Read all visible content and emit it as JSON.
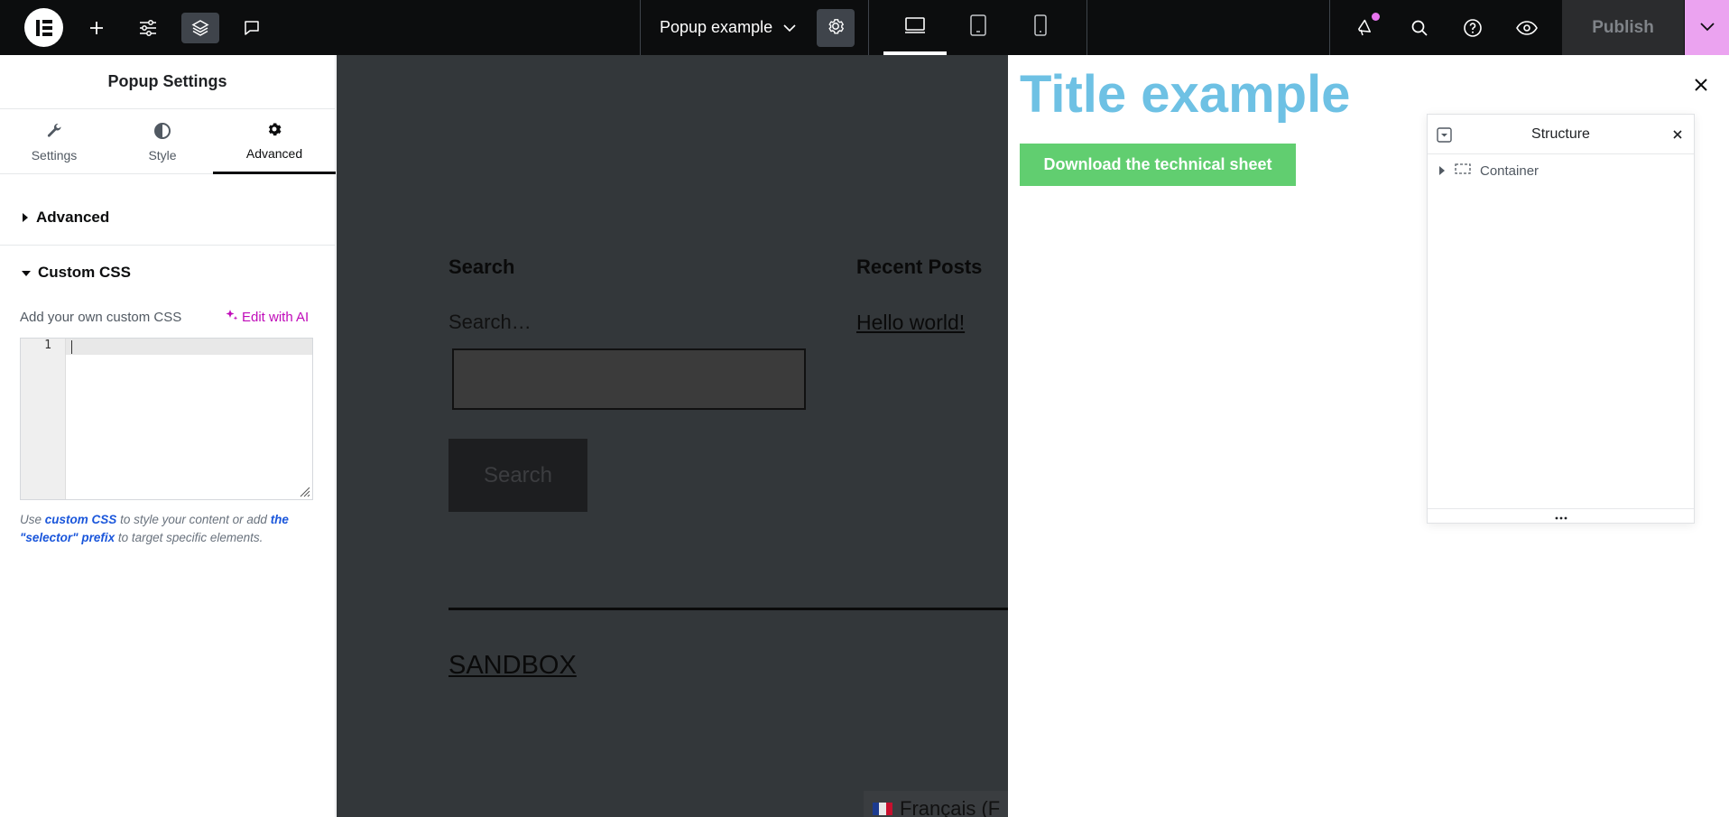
{
  "topbar": {
    "document_title": "Popup example",
    "publish_label": "Publish",
    "icons": [
      "elementor-logo-icon",
      "add-icon",
      "sliders-icon",
      "layers-icon",
      "comment-icon",
      "gear-icon",
      "desktop-icon",
      "tablet-icon",
      "mobile-icon",
      "megaphone-icon",
      "search-icon",
      "help-icon",
      "eye-icon",
      "chevron-down-icon"
    ]
  },
  "panel": {
    "title": "Popup Settings",
    "tabs": [
      {
        "label": "Settings",
        "icon": "wrench-icon"
      },
      {
        "label": "Style",
        "icon": "half-circle-icon"
      },
      {
        "label": "Advanced",
        "icon": "gear-icon",
        "active": true
      }
    ],
    "sections": {
      "advanced": "Advanced",
      "custom_css": "Custom CSS"
    },
    "custom_css_label": "Add your own custom CSS",
    "edit_with_ai": "Edit with AI",
    "line_number": "1",
    "help": {
      "use": "Use",
      "custom_css_link": "custom CSS",
      "middle": "to style your content or add",
      "selector_link": "the \"selector\" prefix",
      "end": "to target specific elements."
    }
  },
  "canvas": {
    "search_heading": "Search",
    "search_label": "Search…",
    "search_button": "Search",
    "recent_heading": "Recent Posts",
    "recent_link": "Hello world!",
    "site_name": "SANDBOX",
    "language": "Français (F"
  },
  "popup": {
    "title": "Title example",
    "cta": "Download the technical sheet"
  },
  "structure": {
    "title": "Structure",
    "items": [
      {
        "label": "Container"
      }
    ]
  },
  "colors": {
    "topbar_bg": "#0c0d0e",
    "canvas_bg": "#33373a",
    "popup_title": "#6ec1e4",
    "cta_bg": "#61ce70",
    "ai_accent": "#c00bb9",
    "publish_more_bg": "#eba3f0"
  }
}
